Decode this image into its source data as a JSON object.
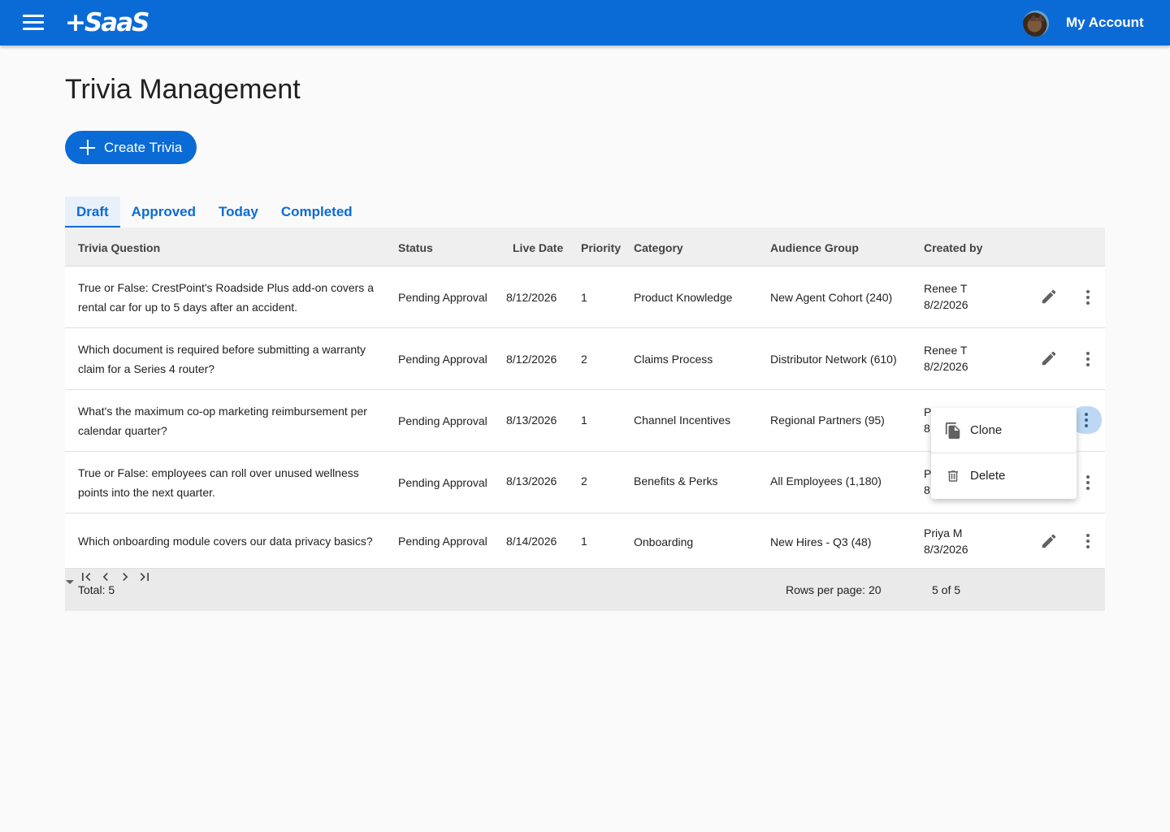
{
  "appbar": {
    "logo": "+SaaS",
    "account_label": "My Account",
    "menu_icon": "hamburger-menu-icon",
    "avatar_icon": "user-avatar"
  },
  "page": {
    "title": "Trivia Management",
    "create_button": "Create Trivia"
  },
  "tabs": [
    {
      "label": "Draft",
      "active": true
    },
    {
      "label": "Approved",
      "active": false
    },
    {
      "label": "Today",
      "active": false
    },
    {
      "label": "Completed",
      "active": false
    }
  ],
  "table": {
    "columns": [
      "Trivia Question",
      "Status",
      "Live Date",
      "Priority",
      "Category",
      "Audience Group",
      "Created by"
    ],
    "rows": [
      {
        "question": "True or False: CrestPoint's Roadside Plus add-on covers a rental car for up to 5 days after an accident.",
        "status": "Pending Approval",
        "live_date": "8/12/2026",
        "priority": "1",
        "category": "Product Knowledge",
        "audience": "New Agent Cohort (240)",
        "created_by": "Renee T",
        "created_date": "8/2/2026"
      },
      {
        "question": "Which document is required before submitting a warranty claim for a Series 4 router?",
        "status": "Pending Approval",
        "live_date": "8/12/2026",
        "priority": "2",
        "category": "Claims Process",
        "audience": "Distributor Network (610)",
        "created_by": "Renee T",
        "created_date": "8/2/2026"
      },
      {
        "question": "What's the maximum co-op marketing reimbursement per calendar quarter?",
        "status": "Pending Approval",
        "live_date": "8/13/2026",
        "priority": "1",
        "category": "Channel Incentives",
        "audience": "Regional Partners (95)",
        "created_by": "P",
        "created_date": "8"
      },
      {
        "question": "True or False: employees can roll over unused wellness points into the next quarter.",
        "status": "Pending Approval",
        "live_date": "8/13/2026",
        "priority": "2",
        "category": "Benefits & Perks",
        "audience": "All Employees (1,180)",
        "created_by": "P",
        "created_date": "8"
      },
      {
        "question": "Which onboarding module covers our data privacy basics?",
        "status": "Pending Approval",
        "live_date": "8/14/2026",
        "priority": "1",
        "category": "Onboarding",
        "audience": "New Hires - Q3 (48)",
        "created_by": "Priya M",
        "created_date": "8/3/2026"
      }
    ]
  },
  "footer": {
    "total": "Total: 5",
    "rows_per_page": "Rows per page: 20",
    "page_info": "5 of 5"
  },
  "context_menu": {
    "items": [
      {
        "label": "Clone",
        "icon": "copy-icon"
      },
      {
        "label": "Delete",
        "icon": "trash-icon"
      }
    ]
  },
  "colors": {
    "primary": "#0b6bd6",
    "tab_active_bg": "#e8f0f9",
    "active_kebab_bg": "#bcd8f5"
  }
}
